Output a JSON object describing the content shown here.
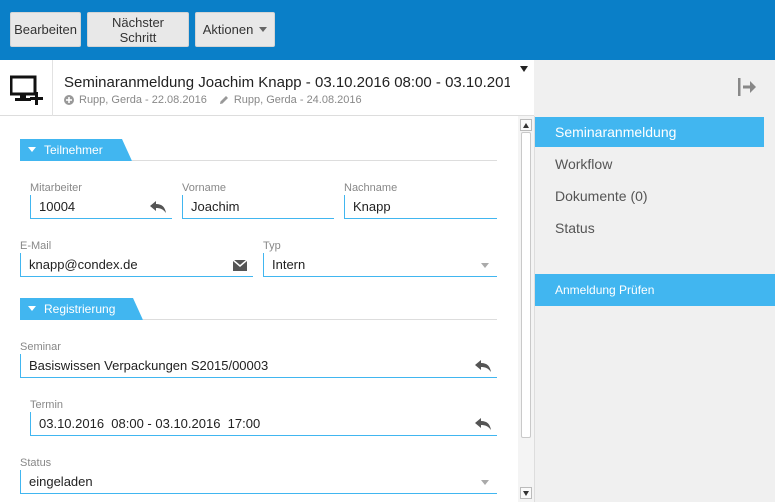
{
  "toolbar": {
    "edit_label": "Bearbeiten",
    "next_step_label": "Nächster Schritt",
    "actions_label": "Aktionen"
  },
  "header": {
    "title": "Seminaranmeldung Joachim Knapp - 03.10.2016 08:00 - 03.10.2016 17...",
    "created": "Rupp, Gerda - 22.08.2016",
    "edited": "Rupp, Gerda - 24.08.2016"
  },
  "sections": {
    "participant": "Teilnehmer",
    "registration": "Registrierung"
  },
  "fields": {
    "employee": {
      "label": "Mitarbeiter",
      "value": "10004"
    },
    "first_name": {
      "label": "Vorname",
      "value": "Joachim"
    },
    "last_name": {
      "label": "Nachname",
      "value": "Knapp"
    },
    "email": {
      "label": "E-Mail",
      "value": "knapp@condex.de"
    },
    "type": {
      "label": "Typ",
      "value": "Intern"
    },
    "seminar": {
      "label": "Seminar",
      "value": "Basiswissen Verpackungen S2015/00003"
    },
    "date": {
      "label": "Termin",
      "value": "03.10.2016  08:00 - 03.10.2016  17:00"
    },
    "status": {
      "label": "Status",
      "value": "eingeladen"
    }
  },
  "nav": {
    "items": [
      {
        "label": "Seminaranmeldung",
        "active": true
      },
      {
        "label": "Workflow",
        "active": false
      },
      {
        "label": "Dokumente (0)",
        "active": false
      },
      {
        "label": "Status",
        "active": false
      }
    ],
    "action_label": "Anmeldung Prüfen"
  },
  "colors": {
    "toolbar_bg": "#0a7fc8",
    "accent": "#41b6f0",
    "sidebar_bg": "#f0f0f0"
  },
  "icons": [
    "monitor-add-icon",
    "plus-circle-icon",
    "pencil-icon",
    "exit-panel-icon",
    "reply-icon",
    "envelope-icon",
    "chevron-down-icon"
  ]
}
